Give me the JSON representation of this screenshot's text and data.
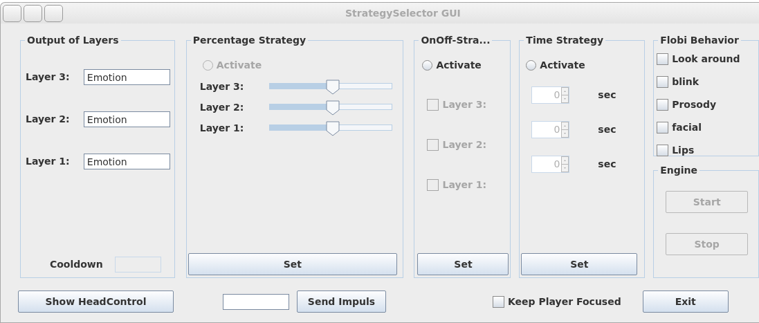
{
  "window": {
    "title": "StrategySelector GUI"
  },
  "output_panel": {
    "title": "Output of Layers",
    "layers": [
      {
        "label": "Layer 3:",
        "value": "Emotion"
      },
      {
        "label": "Layer 2:",
        "value": "Emotion"
      },
      {
        "label": "Layer 1:",
        "value": "Emotion"
      }
    ],
    "cooldown": {
      "label": "Cooldown",
      "disabled": true
    }
  },
  "percentage_panel": {
    "title": "Percentage Strategy",
    "activate": {
      "label": "Activate",
      "selected": false,
      "disabled": true
    },
    "sliders": [
      {
        "label": "Layer 3:",
        "level": 0.52
      },
      {
        "label": "Layer 2:",
        "level": 0.52
      },
      {
        "label": "Layer 1:",
        "level": 0.52
      }
    ],
    "button": "Set"
  },
  "onoff_panel": {
    "title": "OnOff-Stra...",
    "activate": {
      "label": "Activate",
      "selected": false,
      "disabled": false
    },
    "layers": [
      {
        "label": "Layer 3:",
        "checked": false,
        "disabled": true
      },
      {
        "label": "Layer 2:",
        "checked": false,
        "disabled": true
      },
      {
        "label": "Layer 1:",
        "checked": false,
        "disabled": true
      }
    ],
    "button": "Set"
  },
  "time_panel": {
    "title": "Time Strategy",
    "activate": {
      "label": "Activate",
      "selected": false,
      "disabled": false
    },
    "timers": [
      {
        "value": "0",
        "unit": "sec",
        "disabled": true
      },
      {
        "value": "0",
        "unit": "sec",
        "disabled": true
      },
      {
        "value": "0",
        "unit": "sec",
        "disabled": true
      }
    ],
    "button": "Set"
  },
  "flobi_panel": {
    "title": "Flobi Behavior",
    "options": [
      {
        "label": "Look around",
        "checked": false
      },
      {
        "label": "blink",
        "checked": false
      },
      {
        "label": "Prosody",
        "checked": false
      },
      {
        "label": "facial",
        "checked": false
      },
      {
        "label": "Lips",
        "checked": false
      }
    ]
  },
  "engine_panel": {
    "title": "Engine",
    "buttons": [
      {
        "label": "Start",
        "disabled": true
      },
      {
        "label": "Stop",
        "disabled": true
      }
    ]
  },
  "bottom_bar": {
    "head_control_button": "Show HeadControl",
    "send_button": "Send Impuls",
    "keep_focused": {
      "label": "Keep Player Focused",
      "checked": false
    },
    "exit_button": "Exit"
  }
}
